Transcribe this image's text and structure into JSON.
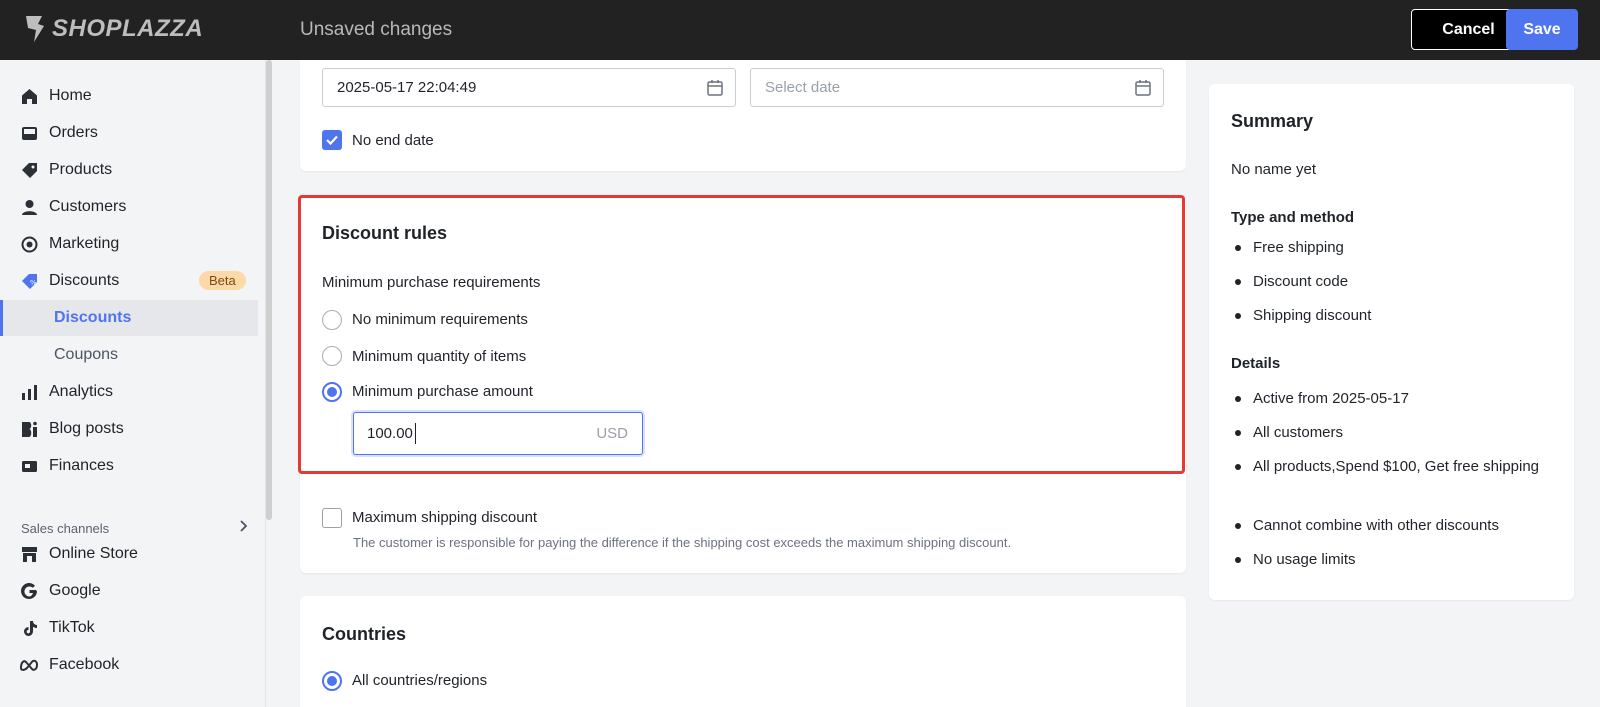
{
  "topbar": {
    "logo_text": "SHOPLAZZA",
    "status": "Unsaved changes",
    "cancel_label": "Cancel",
    "save_label": "Save"
  },
  "sidebar": {
    "items": [
      {
        "label": "Home",
        "icon": "home-icon"
      },
      {
        "label": "Orders",
        "icon": "inbox-icon"
      },
      {
        "label": "Products",
        "icon": "tag-icon"
      },
      {
        "label": "Customers",
        "icon": "person-icon"
      },
      {
        "label": "Marketing",
        "icon": "target-icon"
      },
      {
        "label": "Discounts",
        "icon": "discount-tag-icon",
        "badge": "Beta"
      },
      {
        "label": "Discounts",
        "sub": true,
        "active": true
      },
      {
        "label": "Coupons",
        "sub": true
      },
      {
        "label": "Analytics",
        "icon": "bar-chart-icon"
      },
      {
        "label": "Blog posts",
        "icon": "blog-icon"
      },
      {
        "label": "Finances",
        "icon": "finance-icon"
      }
    ],
    "section_label": "Sales channels",
    "channels": [
      {
        "label": "Online Store",
        "icon": "store-icon"
      },
      {
        "label": "Google",
        "icon": "google-icon"
      },
      {
        "label": "TikTok",
        "icon": "tiktok-icon"
      },
      {
        "label": "Facebook",
        "icon": "meta-icon"
      }
    ]
  },
  "active_dates": {
    "start_value": "2025-05-17 22:04:49",
    "end_placeholder": "Select date",
    "no_end_date_label": "No end date",
    "no_end_date_checked": true
  },
  "discount_rules": {
    "title": "Discount rules",
    "min_req_label": "Minimum purchase requirements",
    "options": [
      {
        "label": "No minimum requirements",
        "selected": false
      },
      {
        "label": "Minimum quantity of items",
        "selected": false
      },
      {
        "label": "Minimum purchase amount",
        "selected": true
      }
    ],
    "amount_value": "100.00",
    "amount_unit": "USD",
    "max_shipping_label": "Maximum shipping discount",
    "max_shipping_checked": false,
    "max_shipping_help": "The customer is responsible for paying the difference if the shipping cost exceeds the maximum shipping discount."
  },
  "countries": {
    "title": "Countries",
    "option_label": "All countries/regions"
  },
  "summary": {
    "title": "Summary",
    "name": "No name yet",
    "type_title": "Type and method",
    "type_items": [
      "Free shipping",
      "Discount code",
      "Shipping discount"
    ],
    "details_title": "Details",
    "detail_items": [
      "Active from 2025-05-17",
      "All customers",
      "All products,Spend $100, Get free shipping",
      "Cannot combine with other discounts",
      "No usage limits"
    ]
  },
  "colors": {
    "accent": "#4f74f0",
    "highlight": "#e53935",
    "topbar": "#222222"
  }
}
